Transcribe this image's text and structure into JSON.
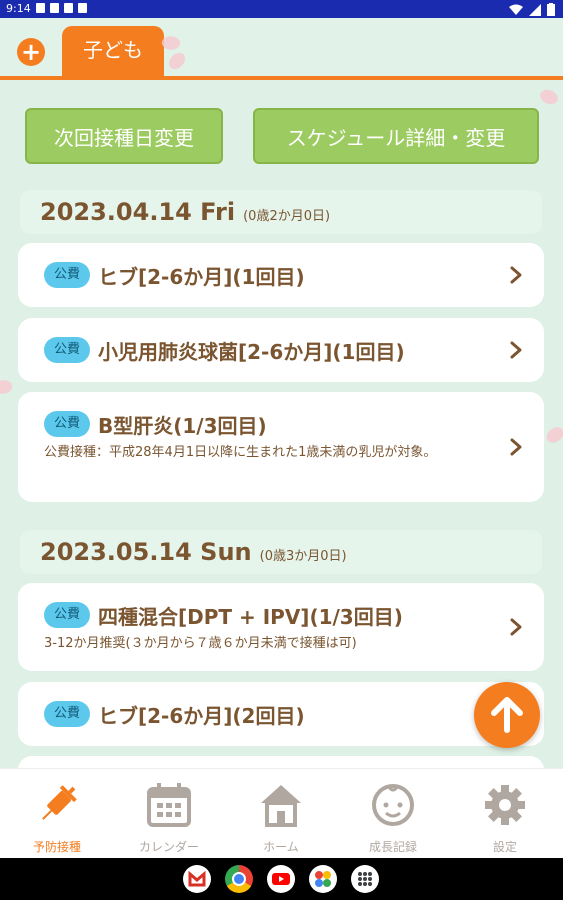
{
  "status_bar": {
    "time": "9:14"
  },
  "header": {
    "tab_label": "子ども"
  },
  "actions": {
    "next_date_button": "次回接種日変更",
    "schedule_button": "スケジュール詳細・変更"
  },
  "groups": [
    {
      "date": "2023.04.14 Fri",
      "age": "(0歳2か月0日)",
      "items": [
        {
          "badge": "公費",
          "title": "ヒブ[2-6か月](1回目)"
        },
        {
          "badge": "公費",
          "title": "小児用肺炎球菌[2-6か月](1回目)"
        },
        {
          "badge": "公費",
          "title": "B型肝炎(1/3回目)",
          "desc": "公費接種：平成28年4月1日以降に生まれた1歳未満の乳児が対象。"
        }
      ]
    },
    {
      "date": "2023.05.14 Sun",
      "age": "(0歳3か月0日)",
      "items": [
        {
          "badge": "公費",
          "title": "四種混合[DPT + IPV](1/3回目)",
          "desc": "3-12か月推奨(３か月から７歳６か月未満で接種は可)"
        },
        {
          "badge": "公費",
          "title": "ヒブ[2-6か月](2回目)"
        }
      ]
    }
  ],
  "nav": [
    {
      "label": "予防接種",
      "icon": "syringe-icon",
      "active": true
    },
    {
      "label": "カレンダー",
      "icon": "calendar-icon"
    },
    {
      "label": "ホーム",
      "icon": "home-icon"
    },
    {
      "label": "成長記録",
      "icon": "baby-face-icon"
    },
    {
      "label": "設定",
      "icon": "gear-icon"
    }
  ],
  "colors": {
    "accent": "#f47d1f",
    "green_button": "#9ccb61",
    "badge": "#5cc8ec",
    "text_brown": "#7a5530",
    "background": "#dff1e6"
  }
}
